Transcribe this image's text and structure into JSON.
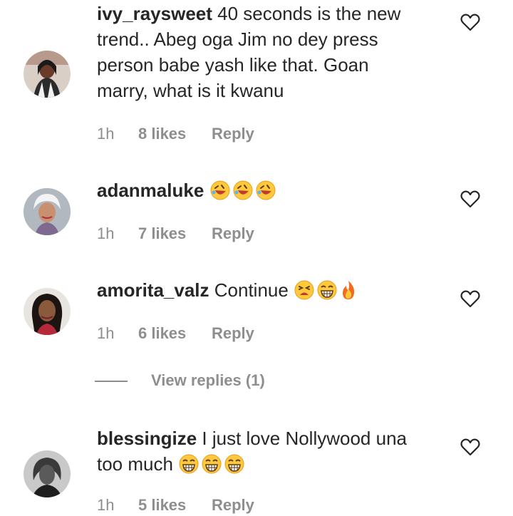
{
  "comments": [
    {
      "username": "ivy_raysweet",
      "text_lines": [
        "40 seconds is the new",
        "trend.. Abeg oga Jim no dey press",
        "person babe yash like that. Goan",
        "marry, what is it kwanu"
      ],
      "emojis": [],
      "time": "1h",
      "likes": "8 likes",
      "reply": "Reply"
    },
    {
      "username": "adanmaluke",
      "text_lines": [
        ""
      ],
      "emojis": [
        "rofl",
        "rofl",
        "rofl"
      ],
      "time": "1h",
      "likes": "7 likes",
      "reply": "Reply"
    },
    {
      "username": "amorita_valz",
      "text_lines": [
        "Continue"
      ],
      "emojis": [
        "tired-face",
        "grin-squint",
        "fire"
      ],
      "time": "1h",
      "likes": "6 likes",
      "reply": "Reply",
      "view_replies": "View replies (1)"
    },
    {
      "username": "blessingize",
      "text_lines": [
        "I just love Nollywood una",
        "too much"
      ],
      "emojis": [
        "grin-squint",
        "grin-squint",
        "grin-squint"
      ],
      "time": "1h",
      "likes": "5 likes",
      "reply": "Reply"
    }
  ],
  "colors": {
    "text": "#262626",
    "secondary": "#8e8e8e",
    "emoji_yellow": "#ffc83d"
  },
  "icons": [
    "heart-outline-icon"
  ]
}
